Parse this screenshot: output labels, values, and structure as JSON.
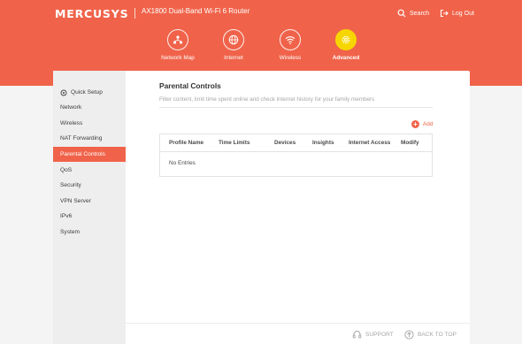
{
  "header": {
    "brand": "MERCUSYS",
    "model": "AX1800 Dual-Band Wi-Fi 6 Router",
    "search_label": "Search",
    "logout_label": "Log Out"
  },
  "nav": [
    {
      "label": "Network Map",
      "icon": "network-map-icon"
    },
    {
      "label": "Internet",
      "icon": "globe-icon"
    },
    {
      "label": "Wireless",
      "icon": "wifi-icon"
    },
    {
      "label": "Advanced",
      "icon": "gear-icon",
      "active": true
    }
  ],
  "sidebar": {
    "items": [
      {
        "label": "Quick Setup",
        "icon": "quick-setup-icon"
      },
      {
        "label": "Network"
      },
      {
        "label": "Wireless"
      },
      {
        "label": "NAT Forwarding"
      },
      {
        "label": "Parental Controls",
        "active": true
      },
      {
        "label": "QoS"
      },
      {
        "label": "Security"
      },
      {
        "label": "VPN Server"
      },
      {
        "label": "IPv6"
      },
      {
        "label": "System"
      }
    ]
  },
  "main": {
    "title": "Parental Controls",
    "description": "Filter content, limit time spent online and check internet history for your family members",
    "add_label": "Add",
    "table": {
      "columns": [
        "Profile Name",
        "Time Limits",
        "Devices",
        "Insights",
        "Internet Access",
        "Modify"
      ],
      "empty_text": "No Entries"
    }
  },
  "footer": {
    "support_label": "SUPPORT",
    "back_to_top_label": "BACK TO TOP"
  },
  "colors": {
    "brand": "#f0634a",
    "active_nav": "#f7d600"
  }
}
